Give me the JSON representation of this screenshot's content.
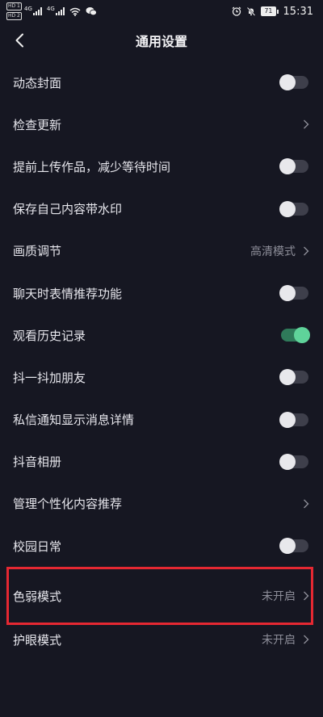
{
  "status_bar": {
    "hd1": "HD 1",
    "hd2": "HD 2",
    "gen1": "4G",
    "gen2": "4G",
    "battery": "71",
    "time": "15:31"
  },
  "header": {
    "title": "通用设置"
  },
  "settings": [
    {
      "label": "动态封面",
      "control": "toggle",
      "on": false
    },
    {
      "label": "检查更新",
      "control": "chevron"
    },
    {
      "label": "提前上传作品，减少等待时间",
      "control": "toggle",
      "on": false
    },
    {
      "label": "保存自己内容带水印",
      "control": "toggle",
      "on": false
    },
    {
      "label": "画质调节",
      "control": "chevron",
      "value": "高清模式"
    },
    {
      "label": "聊天时表情推荐功能",
      "control": "toggle",
      "on": false
    },
    {
      "label": "观看历史记录",
      "control": "toggle",
      "on": true
    },
    {
      "label": "抖一抖加朋友",
      "control": "toggle",
      "on": false
    },
    {
      "label": "私信通知显示消息详情",
      "control": "toggle",
      "on": false
    },
    {
      "label": "抖音相册",
      "control": "toggle",
      "on": false
    },
    {
      "label": "管理个性化内容推荐",
      "control": "chevron"
    },
    {
      "label": "校园日常",
      "control": "toggle",
      "on": false
    },
    {
      "label": "色弱模式",
      "control": "chevron",
      "value": "未开启"
    },
    {
      "label": "护眼模式",
      "control": "chevron",
      "value": "未开启"
    }
  ],
  "colors": {
    "background": "#161722",
    "toggle_on": "#5fd39a",
    "highlight": "#e52832"
  }
}
